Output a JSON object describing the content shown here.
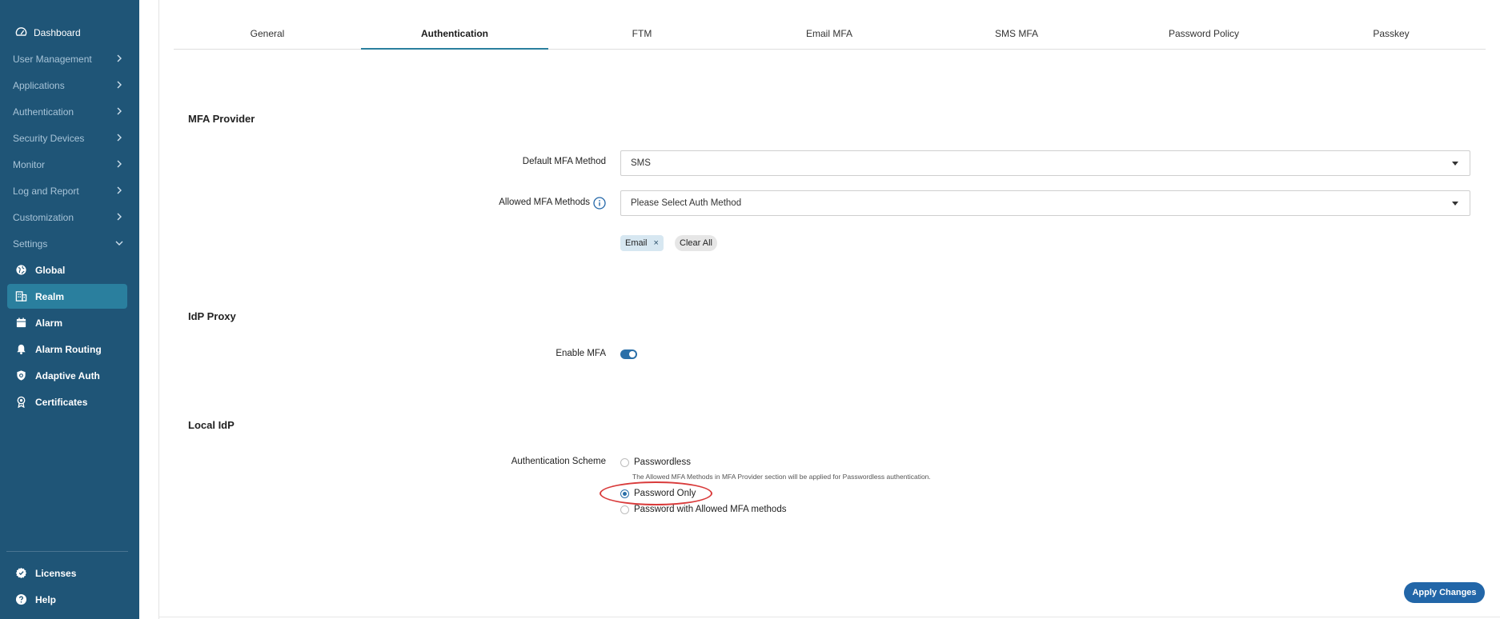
{
  "sidebar": {
    "dashboard": "Dashboard",
    "groups": {
      "user_management": "User Management",
      "applications": "Applications",
      "authentication": "Authentication",
      "security_devices": "Security Devices",
      "monitor": "Monitor",
      "log_and_report": "Log and Report",
      "customization": "Customization",
      "settings": "Settings"
    },
    "settings_items": {
      "global": "Global",
      "realm": "Realm",
      "alarm": "Alarm",
      "alarm_routing": "Alarm Routing",
      "adaptive_auth": "Adaptive Auth",
      "certificates": "Certificates"
    },
    "bottom": {
      "licenses": "Licenses",
      "help": "Help"
    },
    "active_item": "Realm"
  },
  "tabs": {
    "general": "General",
    "authentication": "Authentication",
    "ftm": "FTM",
    "email_mfa": "Email MFA",
    "sms_mfa": "SMS MFA",
    "password_policy": "Password Policy",
    "passkey": "Passkey",
    "active": "Authentication"
  },
  "mfa_provider": {
    "title": "MFA Provider",
    "default_method_label": "Default MFA Method",
    "default_method_value": "SMS",
    "allowed_methods_label": "Allowed MFA Methods",
    "allowed_methods_placeholder": "Please Select Auth Method",
    "selected_chips": [
      "Email"
    ],
    "chip_remove": "×",
    "clear_all": "Clear All"
  },
  "idp_proxy": {
    "title": "IdP Proxy",
    "enable_mfa_label": "Enable MFA",
    "enable_mfa_value": "on"
  },
  "local_idp": {
    "title": "Local IdP",
    "scheme_label": "Authentication Scheme",
    "options": {
      "passwordless": "Passwordless",
      "passwordless_hint": "The Allowed MFA Methods in MFA Provider section will be applied for Passwordless authentication.",
      "password_only": "Password Only",
      "password_with_mfa": "Password with Allowed MFA methods"
    },
    "selected": "Password Only"
  },
  "actions": {
    "apply": "Apply Changes"
  },
  "colors": {
    "sidebar_bg": "#1f5577",
    "active_item_bg": "#2a7f9e",
    "accent": "#2266a8",
    "highlight": "#d93b3b"
  }
}
